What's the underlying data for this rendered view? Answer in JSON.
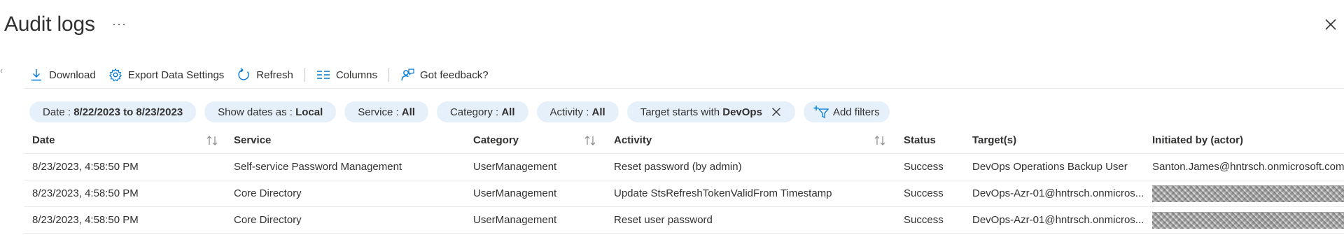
{
  "page": {
    "title": "Audit logs",
    "more_label": "···"
  },
  "toolbar": {
    "download": "Download",
    "export": "Export Data Settings",
    "refresh": "Refresh",
    "columns": "Columns",
    "feedback": "Got feedback?"
  },
  "filters": {
    "date": {
      "label": "Date : ",
      "value": "8/22/2023 to 8/23/2023"
    },
    "show_dates": {
      "label": "Show dates as : ",
      "value": "Local"
    },
    "service": {
      "label": "Service : ",
      "value": "All"
    },
    "category": {
      "label": "Category : ",
      "value": "All"
    },
    "activity": {
      "label": "Activity : ",
      "value": "All"
    },
    "target": {
      "label": "Target starts with ",
      "value": "DevOps"
    },
    "add": "Add filters"
  },
  "table": {
    "headers": {
      "date": "Date",
      "service": "Service",
      "category": "Category",
      "activity": "Activity",
      "status": "Status",
      "targets": "Target(s)",
      "initiated_by": "Initiated by (actor)"
    },
    "rows": [
      {
        "date": "8/23/2023, 4:58:50 PM",
        "service": "Self-service Password Management",
        "category": "UserManagement",
        "activity": "Reset password (by admin)",
        "status": "Success",
        "targets": "DevOps Operations Backup User",
        "initiated_by": "Santon.James@hntrsch.onmicrosoft.com"
      },
      {
        "date": "8/23/2023, 4:58:50 PM",
        "service": "Core Directory",
        "category": "UserManagement",
        "activity": "Update StsRefreshTokenValidFrom Timestamp",
        "status": "Success",
        "targets": "DevOps-Azr-01@hntrsch.onmicros...",
        "initiated_by": ""
      },
      {
        "date": "8/23/2023, 4:58:50 PM",
        "service": "Core Directory",
        "category": "UserManagement",
        "activity": "Reset user password",
        "status": "Success",
        "targets": "DevOps-Azr-01@hntrsch.onmicros...",
        "initiated_by": ""
      }
    ]
  },
  "colors": {
    "accent": "#0078d4",
    "pill_background": "#e6f0fa",
    "text": "#323130",
    "divider": "#edebe9"
  },
  "icons": {
    "download": "download-icon",
    "export": "gear-icon",
    "refresh": "refresh-icon",
    "columns": "columns-icon",
    "feedback": "feedback-icon",
    "add_filter": "add-filter-icon",
    "remove_filter": "close-icon",
    "close": "close-icon",
    "sort": "sort-icon"
  }
}
